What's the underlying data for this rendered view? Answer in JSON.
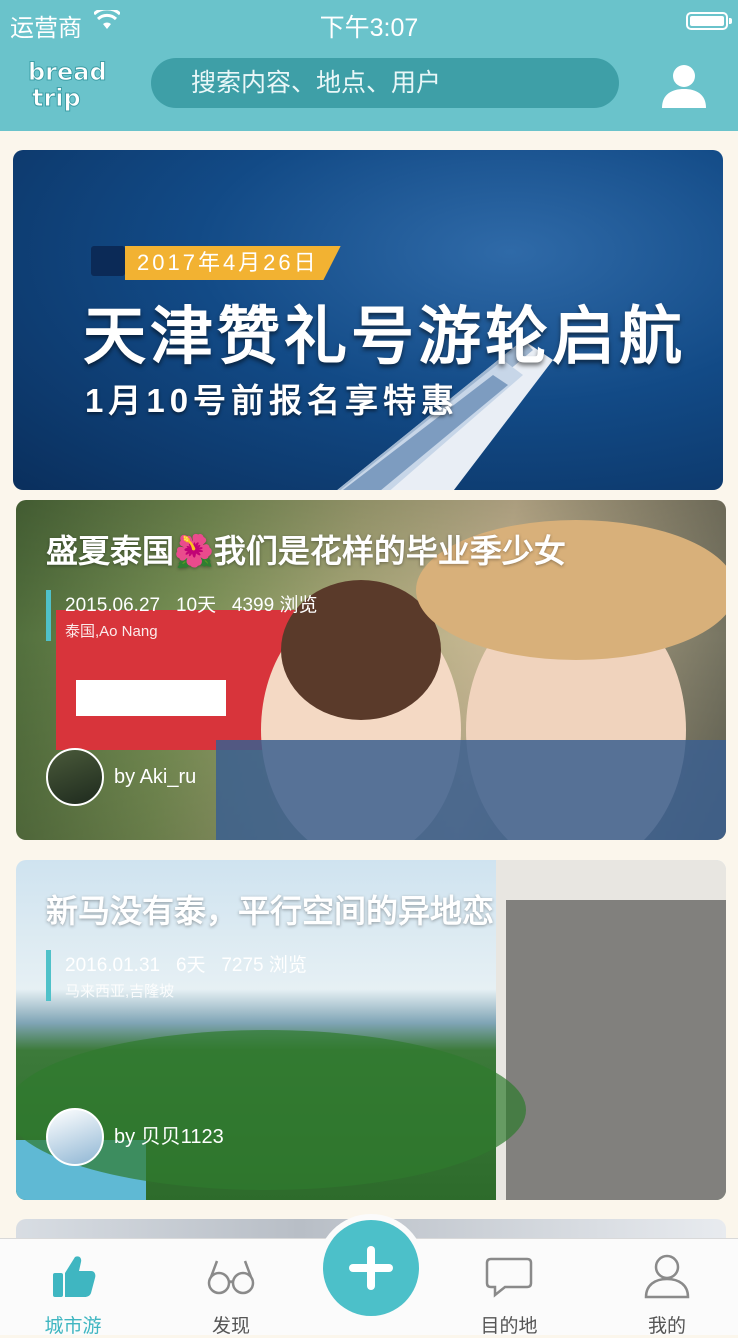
{
  "status_bar": {
    "carrier": "运营商",
    "time": "下午3:07"
  },
  "header": {
    "logo_text_top": "bread",
    "logo_text_bottom": "trip",
    "search_placeholder": "搜索内容、地点、用户"
  },
  "banner": {
    "date": "2017年4月26日",
    "headline": "天津赞礼号游轮启航",
    "subline": "1月10号前报名享特惠"
  },
  "trips": [
    {
      "title": "盛夏泰国🌺我们是花样的毕业季少女",
      "date": "2015.06.27",
      "days": "10天",
      "views": "4399 浏览",
      "location": "泰国,Ao Nang",
      "author": "by Aki_ru"
    },
    {
      "title": "新马没有泰，平行空间的异地恋",
      "date": "2016.01.31",
      "days": "6天",
      "views": "7275 浏览",
      "location": "马来西亚,吉隆坡",
      "author": "by 贝贝1123"
    }
  ],
  "tabs": [
    {
      "label": "城市游",
      "icon": "thumbs-up-icon",
      "active": true
    },
    {
      "label": "发现",
      "icon": "glasses-icon",
      "active": false
    },
    {
      "label": "目的地",
      "icon": "chat-bubble-icon",
      "active": false
    },
    {
      "label": "我的",
      "icon": "person-icon",
      "active": false
    }
  ],
  "colors": {
    "accent": "#4cc0c9",
    "header": "#6ac3cb",
    "search_bg": "#3e9fa7",
    "ribbon": "#f2b232"
  }
}
